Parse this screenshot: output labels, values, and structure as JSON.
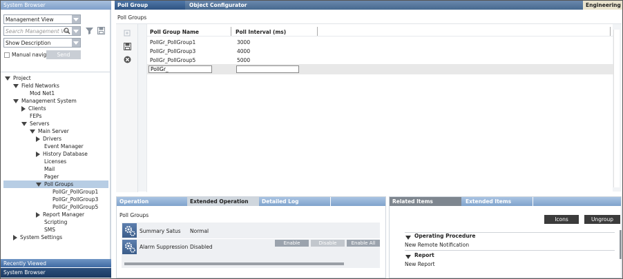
{
  "left_panel": {
    "title": "System Browser",
    "view_select": "Management View",
    "search_placeholder": "Search Management Vie",
    "description_select": "Show Description",
    "manual_nav_label": "Manual navig",
    "send_label": "Send",
    "tree": [
      {
        "label": "Project",
        "level": 0,
        "toggle": "down"
      },
      {
        "label": "Field Networks",
        "level": 1,
        "toggle": "down"
      },
      {
        "label": "Mod Net1",
        "level": 2,
        "toggle": "none"
      },
      {
        "label": "Management System",
        "level": 1,
        "toggle": "down"
      },
      {
        "label": "Clients",
        "level": 2,
        "toggle": "right"
      },
      {
        "label": "FEPs",
        "level": 2,
        "toggle": "none"
      },
      {
        "label": "Servers",
        "level": 2,
        "toggle": "down"
      },
      {
        "label": "Main Server",
        "level": 3,
        "toggle": "down"
      },
      {
        "label": "Drivers",
        "level": 4,
        "toggle": "right"
      },
      {
        "label": "Event Manager",
        "level": 4,
        "toggle": "none"
      },
      {
        "label": "History Database",
        "level": 4,
        "toggle": "right"
      },
      {
        "label": "Licenses",
        "level": 4,
        "toggle": "none"
      },
      {
        "label": "Mail",
        "level": 4,
        "toggle": "none"
      },
      {
        "label": "Pager",
        "level": 4,
        "toggle": "none"
      },
      {
        "label": "Poll Groups",
        "level": 4,
        "toggle": "down",
        "selected": true
      },
      {
        "label": "PollGr_PollGroup1",
        "level": 5,
        "toggle": "none"
      },
      {
        "label": "PollGr_PollGroup3",
        "level": 5,
        "toggle": "none"
      },
      {
        "label": "PollGr_PollGroup5",
        "level": 5,
        "toggle": "none"
      },
      {
        "label": "Report Manager",
        "level": 4,
        "toggle": "right"
      },
      {
        "label": "Scripting",
        "level": 4,
        "toggle": "none"
      },
      {
        "label": "SMS",
        "level": 4,
        "toggle": "none"
      },
      {
        "label": "System Settings",
        "level": 1,
        "toggle": "right"
      }
    ],
    "recently_viewed": "Recently Viewed",
    "bottom_title": "System Browser"
  },
  "top_tabs": {
    "active": "Poll Group",
    "inactive": "Object Configurator",
    "right": "Engineering"
  },
  "poll_groups": {
    "heading": "Poll Groups",
    "columns": [
      "Poll Group Name",
      "Poll Interval (ms)"
    ],
    "rows": [
      {
        "name": "PollGr_PollGroup1",
        "interval": "3000"
      },
      {
        "name": "PollGr_PollGroup3",
        "interval": "4000"
      },
      {
        "name": "PollGr_PollGroup5",
        "interval": "5000"
      }
    ],
    "new_name": "PollGr_",
    "new_interval": ""
  },
  "operation": {
    "tabs": [
      "Operation",
      "Extended Operation",
      "Detailed Log"
    ],
    "heading": "Poll Groups",
    "rows": [
      {
        "label": "Summary Satus",
        "value": "Normal"
      },
      {
        "label": "Alarm Suppression",
        "value": "Disabled"
      }
    ],
    "buttons": [
      "Enable",
      "Disable",
      "Enable All"
    ]
  },
  "related": {
    "tabs": [
      "Related Items",
      "Extended Items"
    ],
    "icons_btn": "Icons",
    "ungroup_btn": "Ungroup",
    "groups": [
      {
        "title": "Operating Procedure",
        "item": "New Remote Notification"
      },
      {
        "title": "Report",
        "item": "New Report"
      }
    ]
  }
}
